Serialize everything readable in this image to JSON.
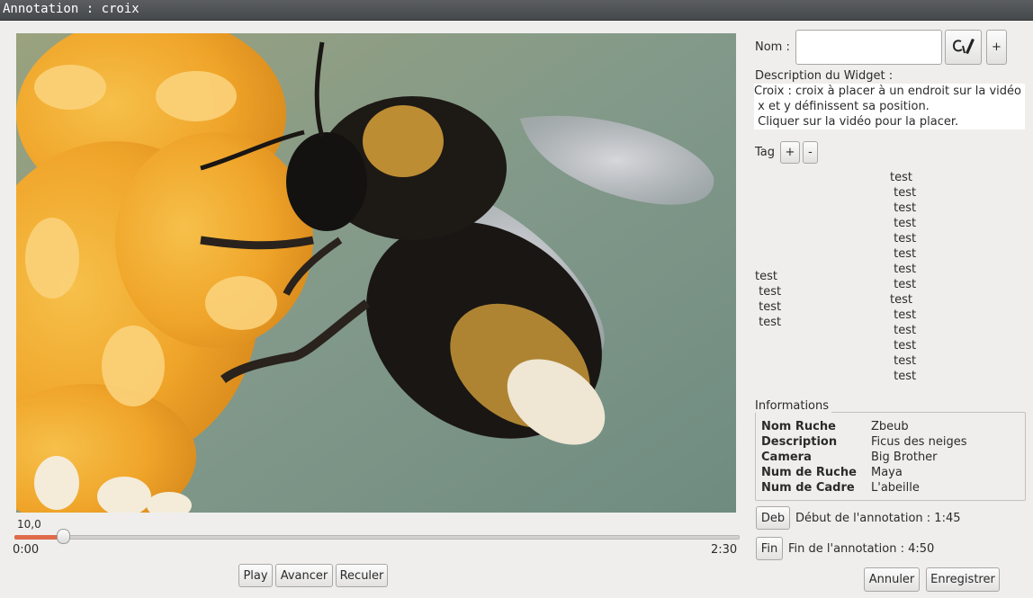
{
  "window": {
    "title": "Annotation : croix"
  },
  "player": {
    "slider_value": "10,0",
    "progress": 0.0667,
    "time_start": "0:00",
    "time_end": "2:30",
    "play_label": "Play",
    "forward_label": "Avancer",
    "back_label": "Reculer"
  },
  "form": {
    "name_label": "Nom :",
    "name_value": "",
    "description_title": "Description du Widget :",
    "description_lines": [
      "Croix : croix à placer à un endroit sur la vidéo",
      " x et y définissent sa position.",
      " Cliquer sur la vidéo pour la placer."
    ],
    "add_label": "+",
    "pen_icon": "pen-icon"
  },
  "tags": {
    "label": "Tag",
    "add_label": "+",
    "remove_label": "-",
    "left_list": [
      "test",
      " test",
      " test",
      " test"
    ],
    "right_list": [
      "test",
      " test",
      " test",
      " test",
      " test",
      " test",
      " test",
      " test",
      "test",
      " test",
      " test",
      " test",
      " test",
      " test"
    ]
  },
  "informations": {
    "title": "Informations",
    "rows": [
      {
        "key": "Nom Ruche",
        "value": "Zbeub"
      },
      {
        "key": "Description",
        "value": "Ficus des neiges"
      },
      {
        "key": "Camera",
        "value": "Big Brother"
      },
      {
        "key": "Num de Ruche",
        "value": "Maya"
      },
      {
        "key": "Num de Cadre",
        "value": "L'abeille"
      }
    ]
  },
  "annotation": {
    "deb_label": "Deb",
    "start_text": "Début de l'annotation : 1:45",
    "fin_label": "Fin",
    "end_text": "Fin de l'annotation : 4:50"
  },
  "actions": {
    "cancel_label": "Annuler",
    "save_label": "Enregistrer"
  }
}
